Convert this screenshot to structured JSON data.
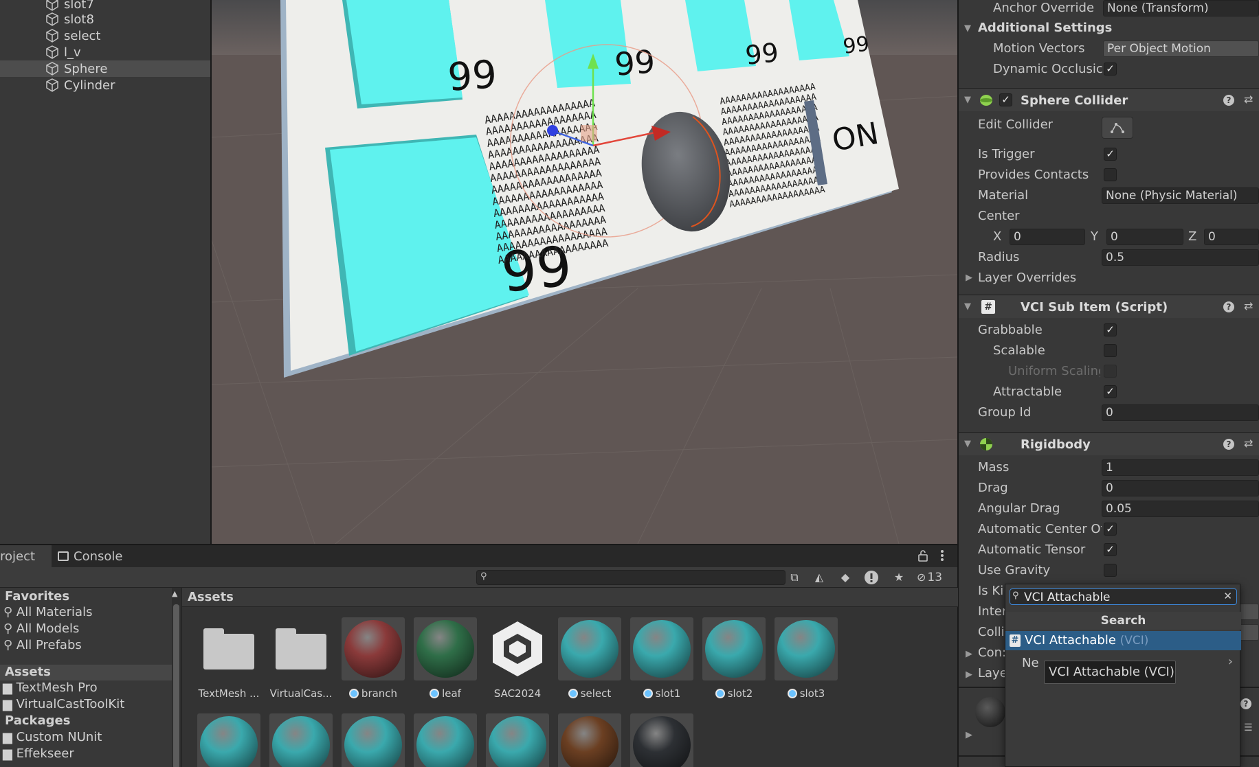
{
  "hierarchy": {
    "items": [
      {
        "label": "slot7"
      },
      {
        "label": "slot8"
      },
      {
        "label": "select"
      },
      {
        "label": "l_v"
      },
      {
        "label": "Sphere",
        "selected": true
      },
      {
        "label": "Cylinder"
      }
    ]
  },
  "scene": {
    "tile_numbers": [
      "99",
      "99",
      "99",
      "99",
      "99"
    ],
    "on_label": "ON",
    "text_fill": "AAAAAAAAAAAAAAAAAA",
    "colors": {
      "cyan": "#5ff2ee",
      "board": "#eeeeeb",
      "floor": "#605654"
    }
  },
  "project": {
    "tabs": [
      {
        "label": "roject"
      },
      {
        "label": "Console"
      }
    ],
    "hidden_count": "13",
    "favorites": {
      "header": "Favorites",
      "items": [
        "All Materials",
        "All Models",
        "All Prefabs"
      ]
    },
    "assets_tree": {
      "header": "Assets",
      "items": [
        "TextMesh Pro",
        "VirtualCastToolKit"
      ]
    },
    "packages_tree": {
      "header": "Packages",
      "items": [
        "Custom NUnit",
        "Effekseer"
      ]
    },
    "grid": {
      "header": "Assets",
      "row1": [
        {
          "name": "TextMesh ...",
          "kind": "folder"
        },
        {
          "name": "VirtualCas...",
          "kind": "folder"
        },
        {
          "name": "branch",
          "kind": "sphere",
          "color": "#8a3a3a",
          "prefab": true
        },
        {
          "name": "leaf",
          "kind": "sphere",
          "color": "#2f6e48",
          "prefab": true
        },
        {
          "name": "SAC2024",
          "kind": "unity-logo"
        },
        {
          "name": "select",
          "kind": "sphere",
          "color": "#3aa9ad",
          "prefab": true
        },
        {
          "name": "slot1",
          "kind": "sphere",
          "color": "#3aa9ad",
          "prefab": true
        },
        {
          "name": "slot2",
          "kind": "sphere",
          "color": "#3aa9ad",
          "prefab": true
        },
        {
          "name": "slot3",
          "kind": "sphere",
          "color": "#3aa9ad",
          "prefab": true
        }
      ],
      "row2_colors": [
        "#3aa9ad",
        "#3aa9ad",
        "#3aa9ad",
        "#3aa9ad",
        "#3aa9ad",
        "#6b3f22",
        "#2d3034"
      ]
    }
  },
  "inspector": {
    "anchor_override_label": "Anchor Override",
    "anchor_override_value": "None (Transform)",
    "additional_settings": "Additional Settings",
    "motion_vectors_label": "Motion Vectors",
    "motion_vectors_value": "Per Object Motion",
    "dynamic_occlusion_label": "Dynamic Occlusic",
    "sphere_collider": {
      "title": "Sphere Collider",
      "edit_collider": "Edit Collider",
      "is_trigger": "Is Trigger",
      "provides_contacts": "Provides Contacts",
      "material_label": "Material",
      "material_value": "None (Physic Material)",
      "center": "Center",
      "x_label": "X",
      "x": "0",
      "y_label": "Y",
      "y": "0",
      "z_label": "Z",
      "z": "0",
      "radius_label": "Radius",
      "radius": "0.5",
      "layer_overrides": "Layer Overrides"
    },
    "vci_sub_item": {
      "title": "VCI Sub Item (Script)",
      "grabbable": "Grabbable",
      "scalable": "Scalable",
      "uniform_scaling": "Uniform Scaling",
      "attractable": "Attractable",
      "group_id_label": "Group Id",
      "group_id": "0"
    },
    "rigidbody": {
      "title": "Rigidbody",
      "mass_label": "Mass",
      "mass": "1",
      "drag_label": "Drag",
      "drag": "0",
      "angular_drag_label": "Angular Drag",
      "angular_drag": "0.05",
      "auto_center": "Automatic Center Of",
      "auto_tensor": "Automatic Tensor",
      "use_gravity": "Use Gravity",
      "is_kinematic": "Is Ki",
      "interpolate": "Inter",
      "collision": "Colli",
      "constraints": "Con:",
      "layer": "Laye"
    }
  },
  "add_component_popup": {
    "search_value": "VCI Attachable",
    "header": "Search",
    "result_label": "VCI Attachable",
    "result_sub": "(VCI)",
    "new_script": "Ne",
    "tooltip": "VCI Attachable (VCI)"
  }
}
